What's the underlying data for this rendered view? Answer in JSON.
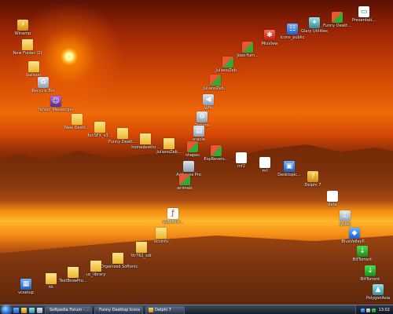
{
  "desktop_icons": {
    "winamp": {
      "label": "Winamp",
      "icon": "winamp-icon"
    },
    "new_folder_2": {
      "label": "New Folder (2)",
      "icon": "folder-icon"
    },
    "balloon": {
      "label": "balloon",
      "icon": "image-icon"
    },
    "recycle_bin": {
      "label": "Recycle Bin",
      "icon": "recycle-bin-icon"
    },
    "yahoo": {
      "label": "Yahoo! Messenger",
      "icon": "yahoo-messenger-icon"
    },
    "new_folder_desktop": {
      "label": "New Deskt...",
      "icon": "folder-icon"
    },
    "funsfx": {
      "label": "funSFX_v3...",
      "icon": "folder-icon"
    },
    "funny_deskt": {
      "label": "Funny Deskt...",
      "icon": "folder-icon"
    },
    "homedesk": {
      "label": "homedeskto...",
      "icon": "folder-icon"
    },
    "julianozeb_center": {
      "label": "JulianoZeb...",
      "icon": "folder-icon"
    },
    "shapes": {
      "label": "shapes",
      "icon": "image-icon"
    },
    "artboxes": {
      "label": "Artboxes Pro",
      "icon": "application-icon"
    },
    "animals": {
      "label": "animals",
      "icon": "image-icon"
    },
    "ssb_flash": {
      "label": "SSB_Blist...",
      "icon": "flash-icon"
    },
    "dcsinfo": {
      "label": "dcsinfo",
      "icon": "folder-icon"
    },
    "ttr": {
      "label": "ttr762_sdr",
      "icon": "folder-icon"
    },
    "uorganized": {
      "label": "uOrganized Softonic",
      "icon": "folder-icon"
    },
    "uc_library": {
      "label": "uc_library",
      "icon": "folder-icon"
    },
    "textbrowser": {
      "label": "TextBrowPro...",
      "icon": "folder-icon"
    },
    "kk": {
      "label": "kk",
      "icon": "folder-icon"
    },
    "vcsetup": {
      "label": "vcsetup",
      "icon": "installer-icon"
    },
    "joao_yuma": {
      "label": "Joao-Yum...",
      "icon": "image-icon"
    },
    "julianozeb_upper": {
      "label": "JulianoZeb...",
      "icon": "image-icon"
    },
    "julianozeb_top": {
      "label": "JulianoZeb...",
      "icon": "image-icon"
    },
    "wfb": {
      "label": "Wfb",
      "icon": "audio-icon"
    },
    "options": {
      "label": "Options",
      "icon": "settings-icon"
    },
    "oracle": {
      "label": "oracle",
      "icon": "database-icon"
    },
    "espalema": {
      "label": "EspRevers...",
      "icon": "image-icon"
    },
    "mf2": {
      "label": "mf2",
      "icon": "document-icon"
    },
    "mf": {
      "label": "mf",
      "icon": "document-icon"
    },
    "desktopic": {
      "label": "Desktopic...",
      "icon": "application-icon"
    },
    "delphi7": {
      "label": "Delphi 7",
      "icon": "delphi-icon"
    },
    "data": {
      "label": "data",
      "icon": "document-icon"
    },
    "syskey": {
      "label": "syskey",
      "icon": "key-icon"
    },
    "bluevalley": {
      "label": "BlueValleyP...",
      "icon": "application-icon"
    },
    "bittorrent_1": {
      "label": "BitTorrent",
      "icon": "bittorrent-icon"
    },
    "bittorrent_2": {
      "label": "BitTorrent",
      "icon": "bittorrent-icon"
    },
    "polygonasia": {
      "label": "PolygonAsia",
      "icon": "image-icon"
    },
    "mixview": {
      "label": "MixView",
      "icon": "mixview-icon"
    },
    "icons_public": {
      "label": "icons_public",
      "icon": "folder-icon"
    },
    "glary": {
      "label": "Glary Utilities",
      "icon": "glary-utilities-icon"
    },
    "funny_desktop_top": {
      "label": "Funny Deskt...",
      "icon": "image-icon"
    },
    "presentation": {
      "label": "Presentati...",
      "icon": "presentation-icon"
    }
  },
  "taskbar": {
    "buttons": [
      {
        "label": "Softpedia Forum - ...",
        "icon": "browser-icon"
      },
      {
        "label": "Funny Desktop Icons",
        "icon": "folder-icon"
      },
      {
        "label": "Delphi 7",
        "icon": "delphi-icon"
      }
    ],
    "clock": "13:02"
  },
  "colors": {
    "sky_dark": "#5a1104",
    "sky_mid": "#cf4505",
    "sunlight": "#ffd24a",
    "taskbar": "#1f2838"
  }
}
